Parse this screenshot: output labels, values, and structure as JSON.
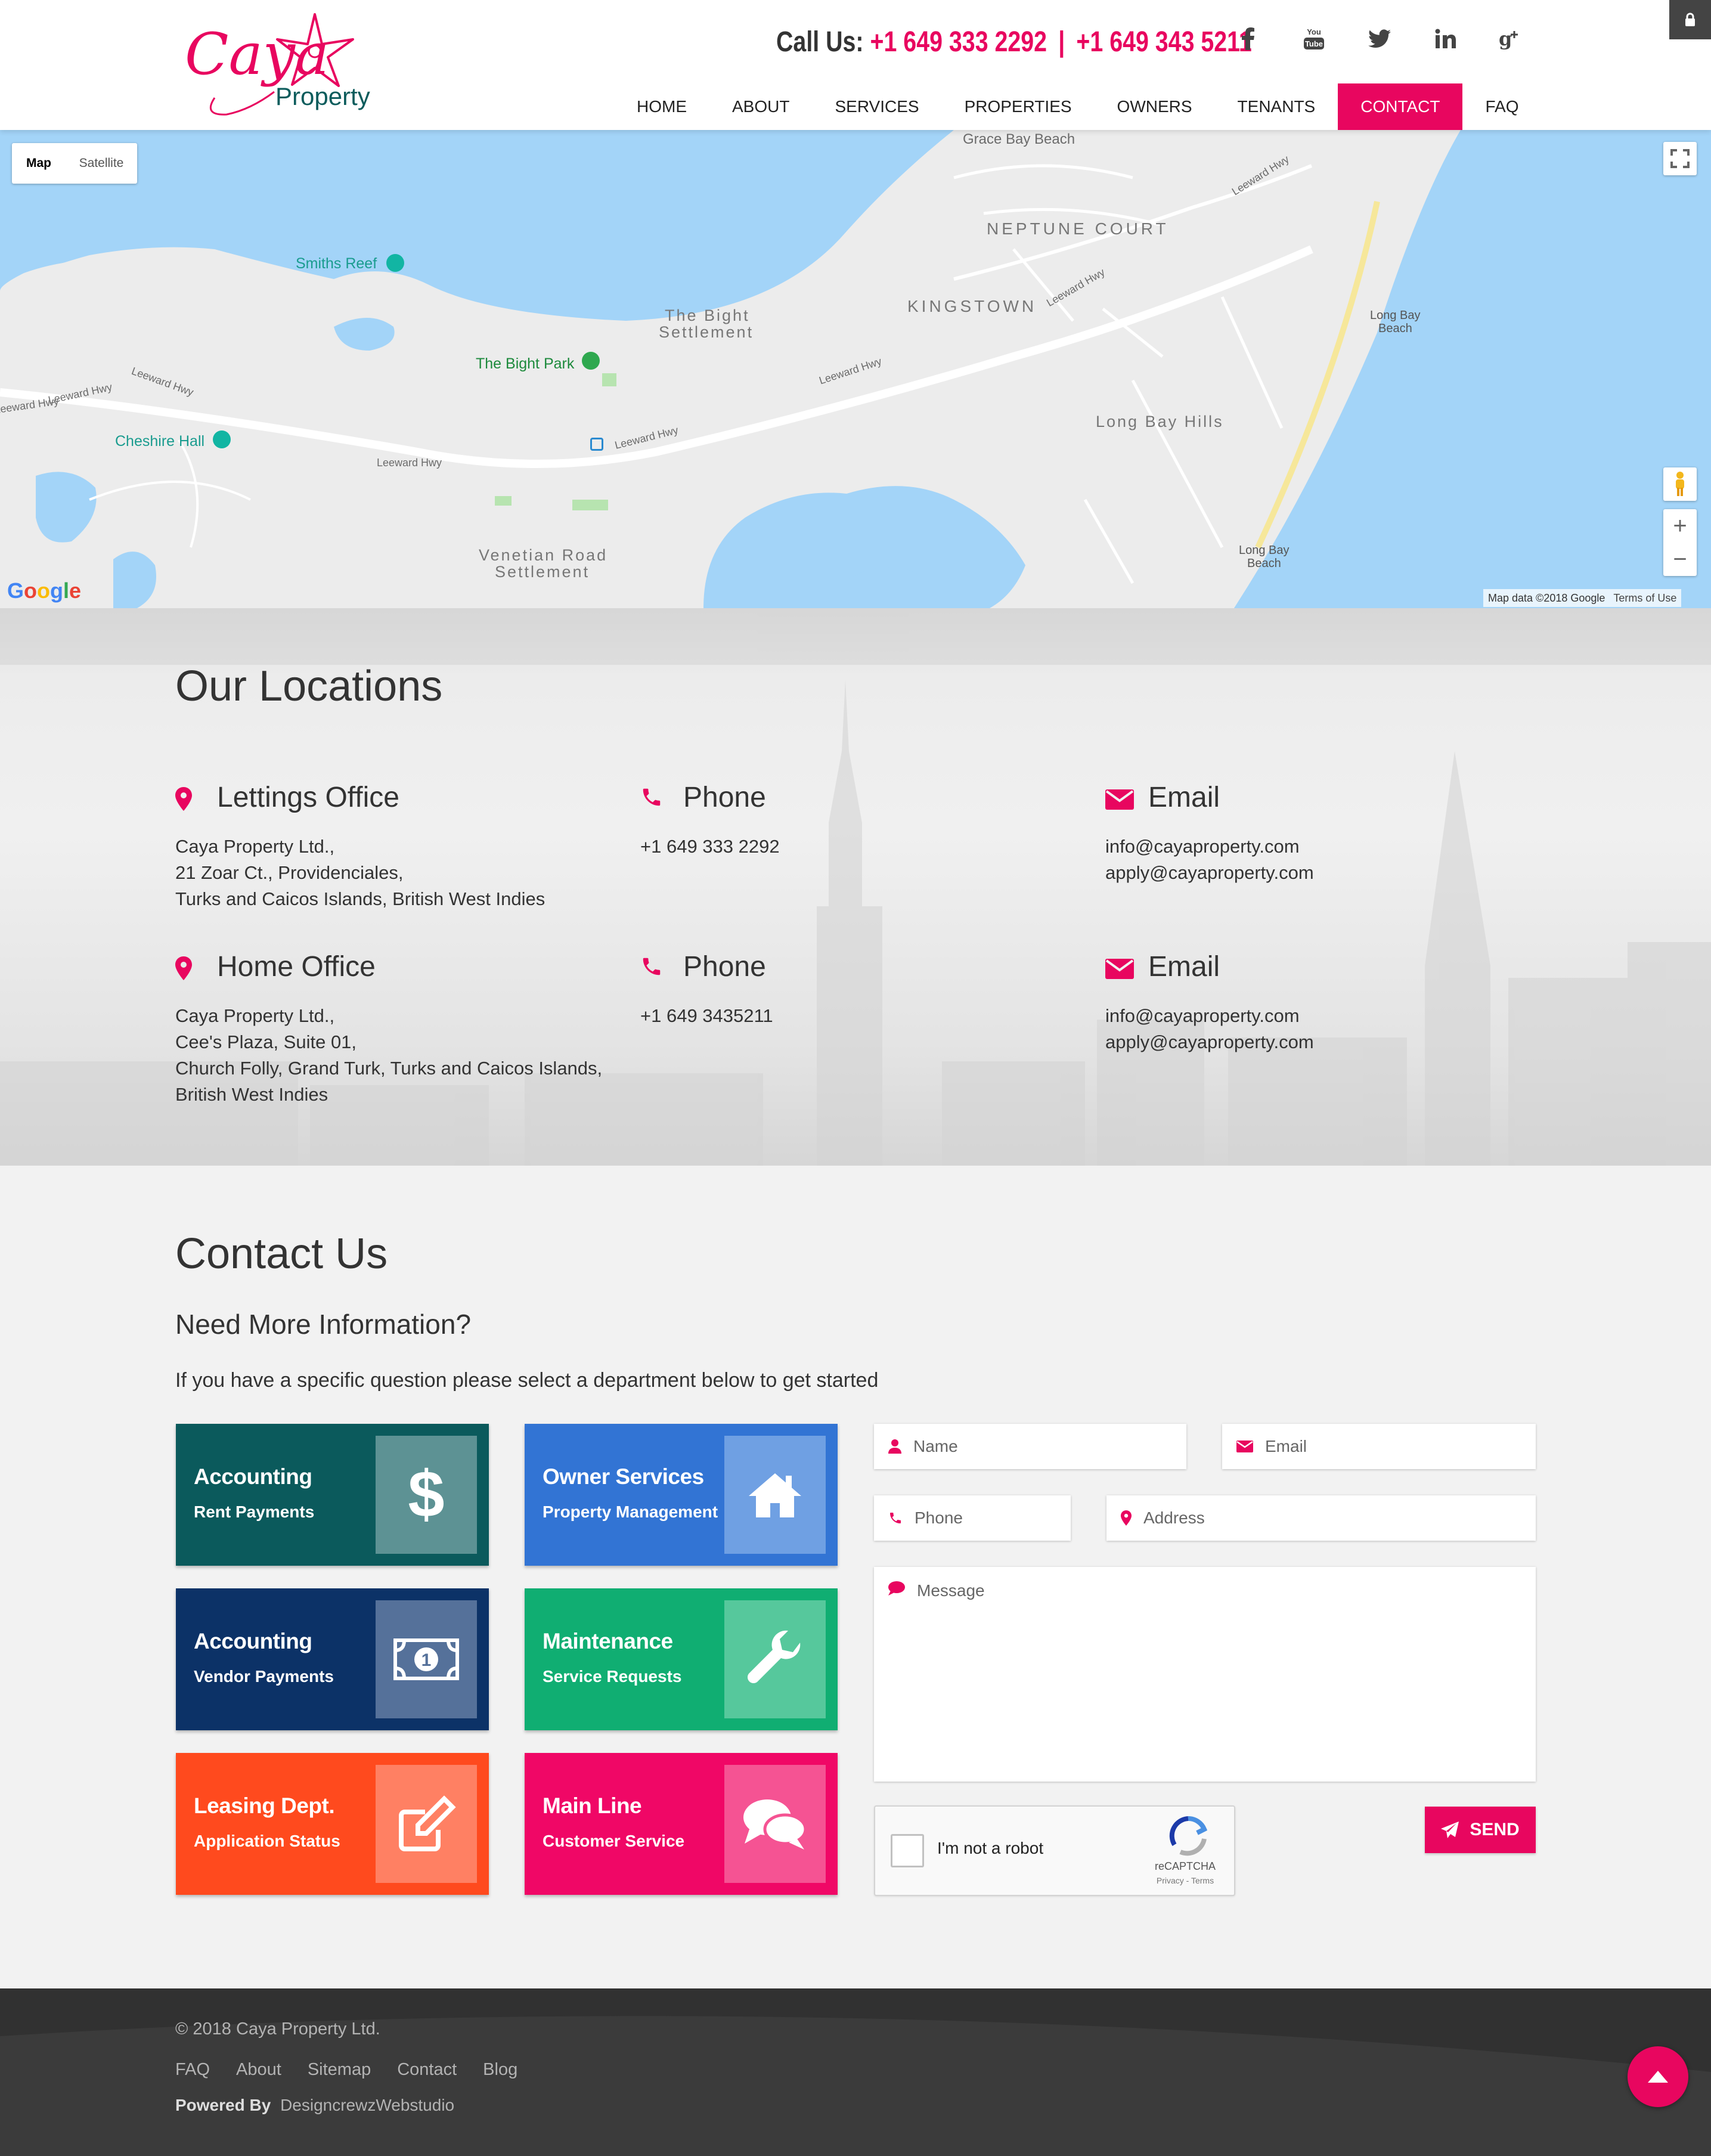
{
  "header": {
    "logo_script": "Caya",
    "logo_sub": "Property",
    "call_label": "Call Us:",
    "phone_1": "+1 649 333 2292",
    "separator": "|",
    "phone_2": "+1 649 343 5211",
    "social": [
      {
        "icon": "facebook-icon",
        "glyph": "f"
      },
      {
        "icon": "youtube-icon",
        "glyph": "You Tube"
      },
      {
        "icon": "twitter-icon",
        "glyph": "twitter"
      },
      {
        "icon": "linkedin-icon",
        "glyph": "in"
      },
      {
        "icon": "google-plus-icon",
        "glyph": "g+"
      }
    ],
    "nav": [
      "HOME",
      "ABOUT",
      "SERVICES",
      "PROPERTIES",
      "OWNERS",
      "TENANTS",
      "CONTACT",
      "FAQ"
    ],
    "active_nav": "CONTACT"
  },
  "map": {
    "type_map": "Map",
    "type_satellite": "Satellite",
    "labels": {
      "grace_bay": "Grace Bay Beach",
      "neptune": "NEPTUNE COURT",
      "kingstown": "KINGSTOWN",
      "smiths_reef": "Smiths Reef",
      "bight_settlement_1": "The Bight",
      "bight_settlement_2": "Settlement",
      "bight_park": "The Bight Park",
      "cheshire": "Cheshire Hall",
      "long_bay_hills": "Long Bay Hills",
      "long_bay_beach_top_1": "Long Bay",
      "long_bay_beach_top_2": "Beach",
      "long_bay_beach_bot_1": "Long Bay",
      "long_bay_beach_bot_2": "Beach",
      "venetian_1": "Venetian Road",
      "venetian_2": "Settlement",
      "leeward_1": "Leeward Hwy",
      "leeward_2": "Leeward Hwy",
      "leeward_3": "Leeward Hwy",
      "leeward_4": "Leeward Hwy",
      "leeward_5": "Leeward Hwy",
      "leeward_6": "Leeward Hwy",
      "leeward_7": "Leeward Hwy",
      "leeward_8": "Leeward Hwy"
    },
    "google": "Google",
    "attribution": "Map data ©2018 Google",
    "terms": "Terms of Use",
    "zoom_in": "+",
    "zoom_out": "−"
  },
  "locations": {
    "title": "Our Locations",
    "offices": [
      {
        "name": "Lettings Office",
        "address": [
          "Caya Property Ltd.,",
          "21 Zoar Ct., Providenciales,",
          "Turks and Caicos Islands, British West Indies"
        ],
        "phone_label": "Phone",
        "phone": "+1 649 333 2292",
        "email_label": "Email",
        "emails": [
          "info@cayaproperty.com",
          "apply@cayaproperty.com"
        ]
      },
      {
        "name": "Home Office",
        "address": [
          "Caya Property Ltd.,",
          "Cee's Plaza, Suite 01,",
          "Church Folly, Grand Turk, Turks and Caicos Islands,",
          "British West Indies"
        ],
        "phone_label": "Phone",
        "phone": "+1 649 3435211",
        "email_label": "Email",
        "emails": [
          "info@cayaproperty.com",
          "apply@cayaproperty.com"
        ]
      }
    ]
  },
  "contact": {
    "title": "Contact Us",
    "subtitle": "Need More Information?",
    "intro": "If you have a specific question please select a department below to get started",
    "departments": [
      {
        "title": "Accounting",
        "sub": "Rent Payments",
        "icon": "dollar-icon",
        "color": "#0b5a5c",
        "icon_bg": "#5d9294"
      },
      {
        "title": "Owner Services",
        "sub": "Property Management",
        "icon": "house-icon",
        "color": "#3274d4",
        "icon_bg": "#6fa0e3"
      },
      {
        "title": "Accounting",
        "sub": "Vendor Payments",
        "icon": "money-bill-icon",
        "color": "#0c3267",
        "icon_bg": "#55719a"
      },
      {
        "title": "Maintenance",
        "sub": "Service Requests",
        "icon": "wrench-icon",
        "color": "#10ae72",
        "icon_bg": "#56c89c"
      },
      {
        "title": "Leasing Dept.",
        "sub": "Application Status",
        "icon": "edit-icon",
        "color": "#ff4a1e",
        "icon_bg": "#ff8063"
      },
      {
        "title": "Main Line",
        "sub": "Customer Service",
        "icon": "chat-icon",
        "color": "#f00766",
        "icon_bg": "#f55393"
      }
    ],
    "form": {
      "name_placeholder": "Name",
      "email_placeholder": "Email",
      "phone_placeholder": "Phone",
      "address_placeholder": "Address",
      "message_placeholder": "Message",
      "captcha_label": "I'm not a robot",
      "captcha_brand": "reCAPTCHA",
      "captcha_links": "Privacy - Terms",
      "send_label": "SEND"
    }
  },
  "footer": {
    "copyright": "© 2018 Caya Property Ltd.",
    "links": [
      "FAQ",
      "About",
      "Sitemap",
      "Contact",
      "Blog"
    ],
    "powered_label": "Powered By",
    "powered_by": "DesigncrewzWebstudio"
  },
  "colors": {
    "brand_pink": "#e8065f",
    "water": "#a3d4f8",
    "footer_bg": "#313131"
  }
}
